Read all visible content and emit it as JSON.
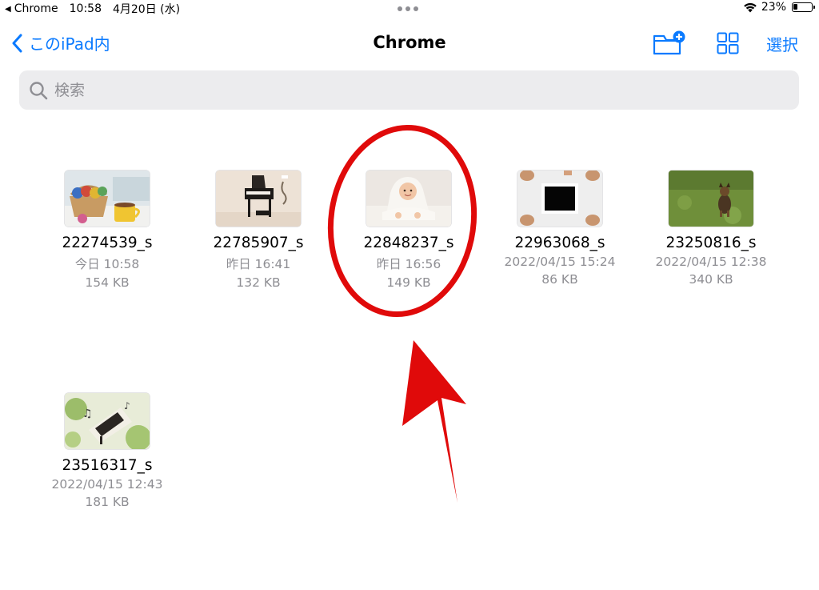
{
  "status_bar": {
    "back_app": "Chrome",
    "time": "10:58",
    "date": "4月20日 (水)",
    "battery_percent": "23%",
    "battery_level": 0.23
  },
  "nav": {
    "back_label": "このiPad内",
    "title": "Chrome",
    "select_label": "選択"
  },
  "search": {
    "placeholder": "検索"
  },
  "files": [
    {
      "name": "22274539_s",
      "date": "今日 10:58",
      "size": "154 KB",
      "thumbnail": "yarn-basket-and-tea-cup"
    },
    {
      "name": "22785907_s",
      "date": "昨日 16:41",
      "size": "132 KB",
      "thumbnail": "miniature-piano"
    },
    {
      "name": "22848237_s",
      "date": "昨日 16:56",
      "size": "149 KB",
      "thumbnail": "baby-in-towel"
    },
    {
      "name": "22963068_s",
      "date": "2022/04/15 15:24",
      "size": "86 KB",
      "thumbnail": "hands-holding-tablet"
    },
    {
      "name": "23250816_s",
      "date": "2022/04/15 12:38",
      "size": "340 KB",
      "thumbnail": "dog-on-grass"
    },
    {
      "name": "23516317_s",
      "date": "2022/04/15 12:43",
      "size": "181 KB",
      "thumbnail": "piano-with-music-notes"
    }
  ],
  "colors": {
    "accent": "#0a7aff",
    "annotation": "#e00a0a",
    "secondary_text": "#8e8e93",
    "search_bg": "#ececee"
  }
}
